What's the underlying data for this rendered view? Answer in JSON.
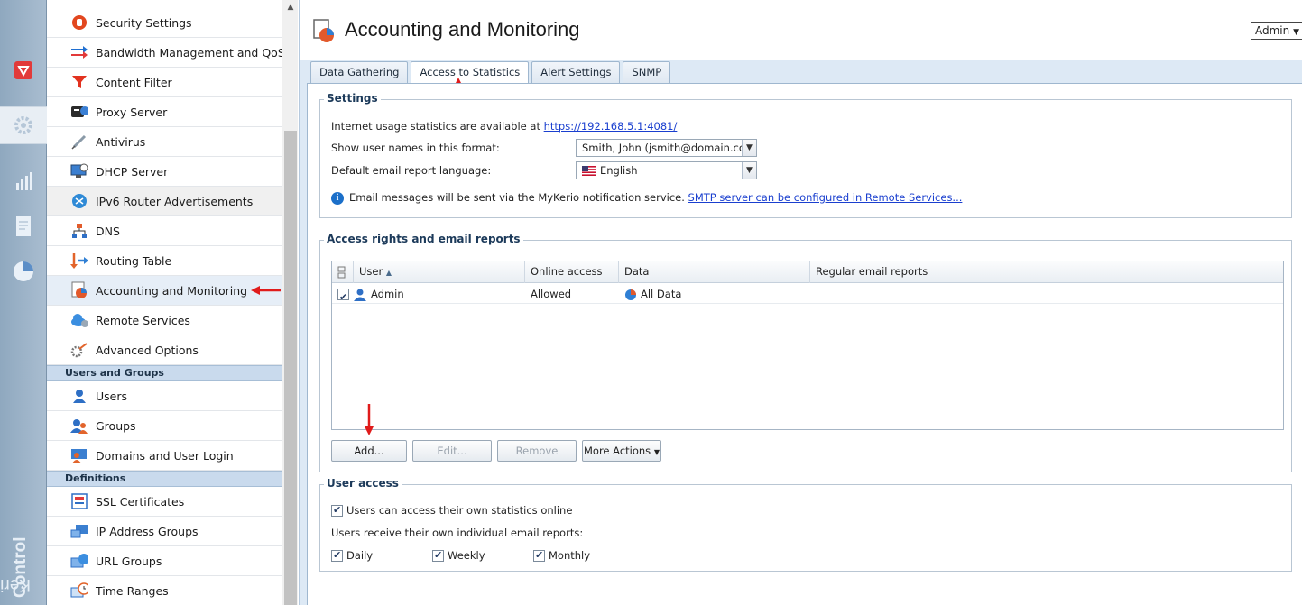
{
  "rail": {
    "brand_light": "Kerio",
    "brand_bold": "Control",
    "items": [
      {
        "name": "dashboard",
        "icon": "shield-check-icon"
      },
      {
        "name": "configuration",
        "icon": "gear-icon",
        "active": true
      },
      {
        "name": "status",
        "icon": "bar-chart-icon"
      },
      {
        "name": "logs",
        "icon": "document-icon"
      },
      {
        "name": "statistics",
        "icon": "pie-chart-icon"
      }
    ]
  },
  "nav": {
    "items": [
      {
        "label": "Security Settings",
        "icon": "stop-hand-icon"
      },
      {
        "label": "Bandwidth Management and QoS",
        "icon": "bandwidth-arrows-icon"
      },
      {
        "label": "Content Filter",
        "icon": "funnel-icon"
      },
      {
        "label": "Proxy Server",
        "icon": "proxy-server-icon"
      },
      {
        "label": "Antivirus",
        "icon": "syringe-icon"
      },
      {
        "label": "DHCP Server",
        "icon": "dhcp-monitor-icon"
      },
      {
        "label": "IPv6 Router Advertisements",
        "icon": "router-icon"
      },
      {
        "label": "DNS",
        "icon": "network-tree-icon"
      },
      {
        "label": "Routing Table",
        "icon": "routing-arrows-icon"
      },
      {
        "label": "Accounting and Monitoring",
        "icon": "accounting-chart-icon"
      },
      {
        "label": "Remote Services",
        "icon": "cloud-gear-icon"
      },
      {
        "label": "Advanced Options",
        "icon": "tools-icon"
      }
    ],
    "header_users": "Users and Groups",
    "users_items": [
      {
        "label": "Users",
        "icon": "user-icon"
      },
      {
        "label": "Groups",
        "icon": "group-icon"
      },
      {
        "label": "Domains and User Login",
        "icon": "domain-user-icon"
      }
    ],
    "header_definitions": "Definitions",
    "definitions_items": [
      {
        "label": "SSL Certificates",
        "icon": "certificate-icon"
      },
      {
        "label": "IP Address Groups",
        "icon": "ip-group-icon"
      },
      {
        "label": "URL Groups",
        "icon": "url-group-icon"
      },
      {
        "label": "Time Ranges",
        "icon": "clock-icon"
      }
    ]
  },
  "main": {
    "title": "Accounting and Monitoring",
    "admin_label": "Admin",
    "tabs": [
      "Data Gathering",
      "Access to Statistics",
      "Alert Settings",
      "SNMP"
    ],
    "active_tab": "Access to Statistics",
    "settings": {
      "title": "Settings",
      "stats_text": "Internet usage statistics are available at ",
      "stats_url": "https://192.168.5.1:4081/",
      "user_format_label": "Show user names in this format:",
      "user_format_value": "Smith, John (jsmith@domain.com)",
      "language_label": "Default email report language:",
      "language_value": "English",
      "info_text": "Email messages will be sent via the MyKerio notification service. ",
      "info_link": "SMTP server can be configured in Remote Services..."
    },
    "access": {
      "title": "Access rights and email reports",
      "columns": [
        "User",
        "Online access",
        "Data",
        "Regular email reports"
      ],
      "rows": [
        {
          "user": "Admin",
          "online": "Allowed",
          "data": "All Data",
          "reports": "",
          "checked": true
        }
      ],
      "buttons": {
        "add": "Add...",
        "edit": "Edit...",
        "remove": "Remove",
        "more": "More Actions"
      }
    },
    "user_access": {
      "title": "User access",
      "own_stats": "Users can access their own statistics online",
      "reports_label": "Users receive their own individual email reports:",
      "daily": "Daily",
      "weekly": "Weekly",
      "monthly": "Monthly"
    }
  },
  "colors": {
    "annotation_arrow": "#e01b1b",
    "link": "#1a3fcf",
    "section_header": "#c9daed"
  }
}
